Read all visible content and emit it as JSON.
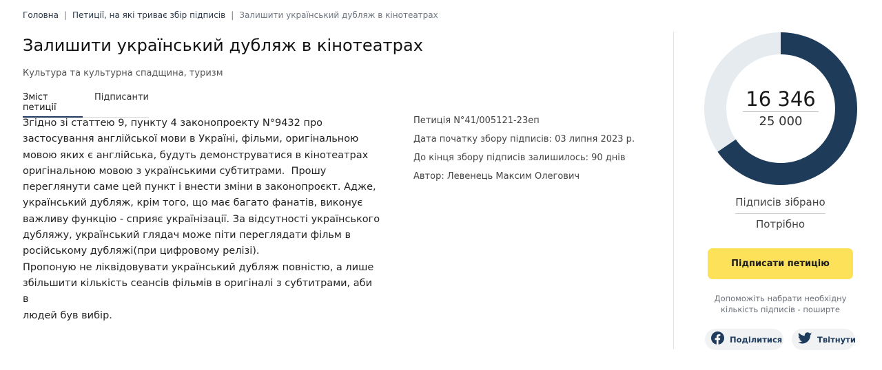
{
  "breadcrumb": {
    "home": "Головна",
    "section": "Петиції, на які триває збір підписів",
    "current": "Залишити український дубляж в кінотеатрах"
  },
  "petition": {
    "title": "Залишити український дубляж в кінотеатрах",
    "category": "Культура та культурна спадщина, туризм",
    "tabs": [
      {
        "label": "Зміст петиції",
        "active": true
      },
      {
        "label": "Підписанти",
        "active": false
      }
    ],
    "body": "Згідно зі статтею 9, пункту 4 законопроекту N°9432 про\nзастосування англійської мови в Україні, фільми, оригінальною\nмовою яких є англійська, будуть демонструватися в кінотеатрах\nоригінальною мовою з українськими субтитрами.  Прошу\nпереглянути саме цей пункт і внести зміни в законопроєкт. Адже,\nукраїнський дубляж, крім того, що має багато фанатів, виконує\nважливу функцію - сприяє українізації. За відсутності українського\nдубляжу, український глядач може піти переглядати фільм в\nросійському дубляжі(при цифровому релізі).\nПропоную не ліквідовувати український дубляж повністю, а лише\nзбільшити кількість сеансів фільмів в оригіналі з субтитрами, аби в\nлюдей був вибір.",
    "meta": {
      "number": "Петиція N°41/005121-23еп",
      "start_date": "Дата початку збору підписів: 03 липня 2023 р.",
      "days_left": "До кінця збору підписів залишилось: 90 днів",
      "author": "Автор: Левенець Максим Олегович"
    }
  },
  "signatures": {
    "collected": "16 346",
    "needed": "25 000",
    "progress_fraction": 0.654,
    "collected_label": "Підписів зібрано",
    "needed_label": "Потрібно",
    "colors": {
      "filled": "#1f3b5a",
      "track": "#e6ebf0"
    }
  },
  "actions": {
    "sign_label": "Підписати петицію",
    "help_text": "Допоможіть набрати необхідну кількість підписів - поширте",
    "share_facebook": "Поділитися",
    "share_twitter": "Твітнути",
    "accent_color": "#fde159",
    "icons": {
      "facebook": "facebook-icon",
      "twitter": "twitter-icon"
    }
  }
}
